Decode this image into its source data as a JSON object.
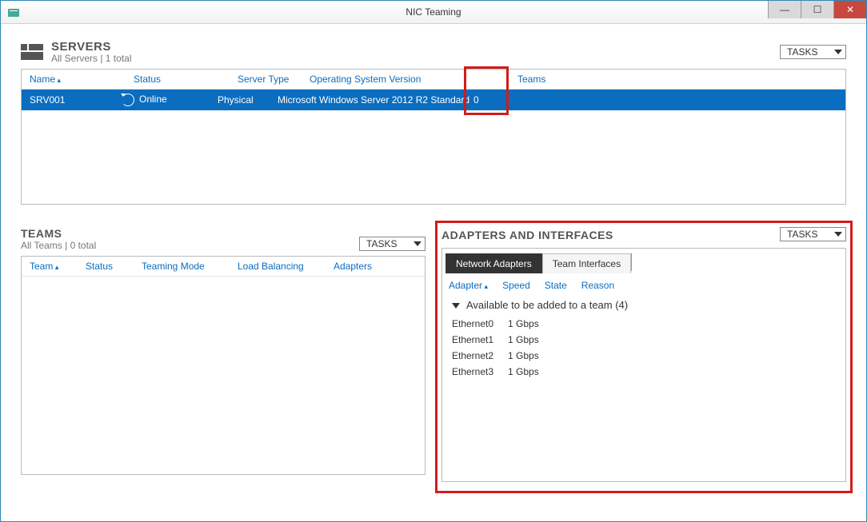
{
  "window": {
    "title": "NIC Teaming"
  },
  "tasks_label": "TASKS",
  "servers": {
    "title": "SERVERS",
    "subtitle": "All Servers | 1 total",
    "columns": {
      "name": "Name",
      "status": "Status",
      "type": "Server Type",
      "os": "Operating System Version",
      "teams": "Teams"
    },
    "row": {
      "name": "SRV001",
      "status": "Online",
      "type": "Physical",
      "os": "Microsoft Windows Server 2012 R2 Standard",
      "teams": "0"
    }
  },
  "teams": {
    "title": "TEAMS",
    "subtitle": "All Teams | 0 total",
    "columns": {
      "team": "Team",
      "status": "Status",
      "mode": "Teaming Mode",
      "lb": "Load Balancing",
      "adapters": "Adapters"
    }
  },
  "adapters": {
    "title": "ADAPTERS AND INTERFACES",
    "tabs": {
      "network": "Network Adapters",
      "team": "Team Interfaces"
    },
    "columns": {
      "adapter": "Adapter",
      "speed": "Speed",
      "state": "State",
      "reason": "Reason"
    },
    "group": "Available to be added to a team (4)",
    "items": [
      {
        "name": "Ethernet0",
        "speed": "1 Gbps"
      },
      {
        "name": "Ethernet1",
        "speed": "1 Gbps"
      },
      {
        "name": "Ethernet2",
        "speed": "1 Gbps"
      },
      {
        "name": "Ethernet3",
        "speed": "1 Gbps"
      }
    ]
  }
}
